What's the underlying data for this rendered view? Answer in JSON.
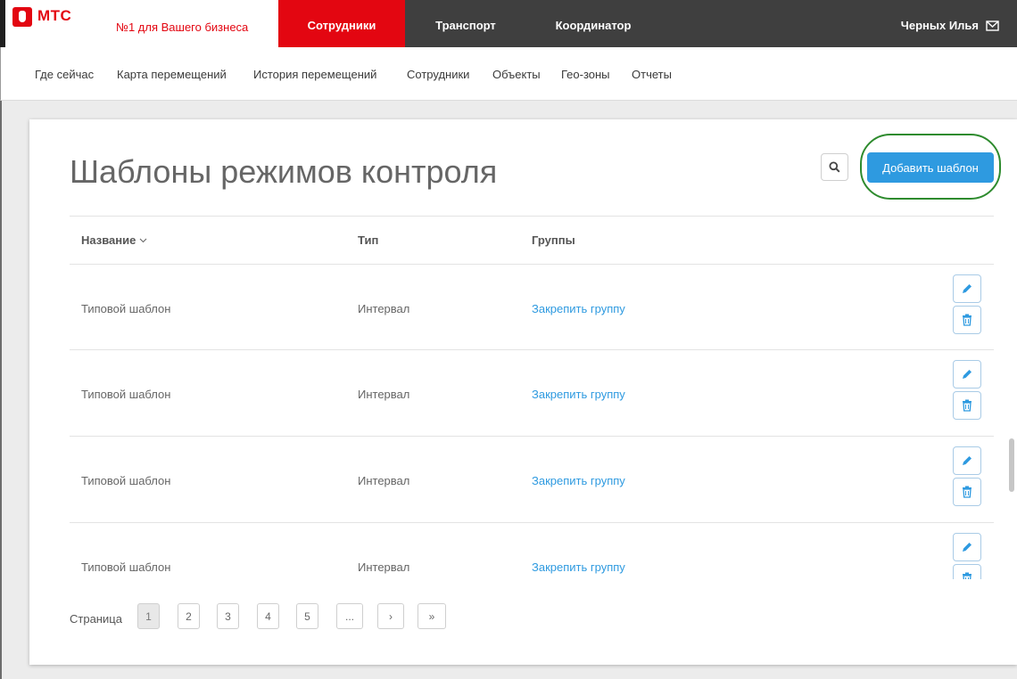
{
  "header": {
    "logo": "МТС",
    "slogan": "№1 для Вашего бизнеса",
    "nav": [
      "Сотрудники",
      "Транспорт",
      "Координатор"
    ],
    "user_name": "Черных Илья",
    "brand_color": "#e30611"
  },
  "subnav": {
    "items": [
      "Где сейчас",
      "Карта перемещений",
      "История перемещений",
      "Сотрудники",
      "Объекты",
      "Гео-зоны",
      "Отчеты"
    ]
  },
  "main": {
    "title": "Шаблоны режимов контроля",
    "add_button": "Добавить шаблон",
    "columns": [
      "Название",
      "Тип",
      "Группы"
    ],
    "rows": [
      {
        "name": "Типовой шаблон",
        "type": "Интервал",
        "groups": "Закрепить группу"
      },
      {
        "name": "Типовой шаблон",
        "type": "Интервал",
        "groups": "Закрепить группу"
      },
      {
        "name": "Типовой шаблон",
        "type": "Интервал",
        "groups": "Закрепить группу"
      },
      {
        "name": "Типовой шаблон",
        "type": "Интервал",
        "groups": "Закрепить группу"
      }
    ]
  },
  "pagination": {
    "label": "Страница",
    "pages": [
      "1",
      "2",
      "3",
      "4",
      "5",
      "...",
      "›",
      "»"
    ],
    "current": "1"
  },
  "colors": {
    "accent": "#2e9ae0",
    "highlight": "#2e8b2e"
  }
}
